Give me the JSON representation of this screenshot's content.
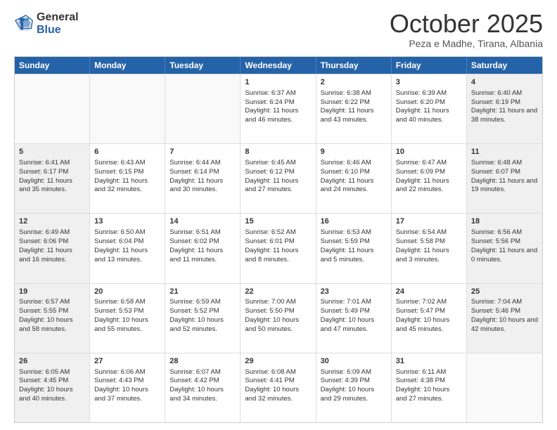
{
  "logo": {
    "general": "General",
    "blue": "Blue"
  },
  "header": {
    "month": "October 2025",
    "location": "Peza e Madhe, Tirana, Albania"
  },
  "days": [
    "Sunday",
    "Monday",
    "Tuesday",
    "Wednesday",
    "Thursday",
    "Friday",
    "Saturday"
  ],
  "rows": [
    [
      {
        "num": "",
        "info": "",
        "empty": true
      },
      {
        "num": "",
        "info": "",
        "empty": true
      },
      {
        "num": "",
        "info": "",
        "empty": true
      },
      {
        "num": "1",
        "info": "Sunrise: 6:37 AM\nSunset: 6:24 PM\nDaylight: 11 hours and 46 minutes."
      },
      {
        "num": "2",
        "info": "Sunrise: 6:38 AM\nSunset: 6:22 PM\nDaylight: 11 hours and 43 minutes."
      },
      {
        "num": "3",
        "info": "Sunrise: 6:39 AM\nSunset: 6:20 PM\nDaylight: 11 hours and 40 minutes."
      },
      {
        "num": "4",
        "info": "Sunrise: 6:40 AM\nSunset: 6:19 PM\nDaylight: 11 hours and 38 minutes.",
        "shaded": true
      }
    ],
    [
      {
        "num": "5",
        "info": "Sunrise: 6:41 AM\nSunset: 6:17 PM\nDaylight: 11 hours and 35 minutes.",
        "shaded": true
      },
      {
        "num": "6",
        "info": "Sunrise: 6:43 AM\nSunset: 6:15 PM\nDaylight: 11 hours and 32 minutes."
      },
      {
        "num": "7",
        "info": "Sunrise: 6:44 AM\nSunset: 6:14 PM\nDaylight: 11 hours and 30 minutes."
      },
      {
        "num": "8",
        "info": "Sunrise: 6:45 AM\nSunset: 6:12 PM\nDaylight: 11 hours and 27 minutes."
      },
      {
        "num": "9",
        "info": "Sunrise: 6:46 AM\nSunset: 6:10 PM\nDaylight: 11 hours and 24 minutes."
      },
      {
        "num": "10",
        "info": "Sunrise: 6:47 AM\nSunset: 6:09 PM\nDaylight: 11 hours and 22 minutes."
      },
      {
        "num": "11",
        "info": "Sunrise: 6:48 AM\nSunset: 6:07 PM\nDaylight: 11 hours and 19 minutes.",
        "shaded": true
      }
    ],
    [
      {
        "num": "12",
        "info": "Sunrise: 6:49 AM\nSunset: 6:06 PM\nDaylight: 11 hours and 16 minutes.",
        "shaded": true
      },
      {
        "num": "13",
        "info": "Sunrise: 6:50 AM\nSunset: 6:04 PM\nDaylight: 11 hours and 13 minutes."
      },
      {
        "num": "14",
        "info": "Sunrise: 6:51 AM\nSunset: 6:02 PM\nDaylight: 11 hours and 11 minutes."
      },
      {
        "num": "15",
        "info": "Sunrise: 6:52 AM\nSunset: 6:01 PM\nDaylight: 11 hours and 8 minutes."
      },
      {
        "num": "16",
        "info": "Sunrise: 6:53 AM\nSunset: 5:59 PM\nDaylight: 11 hours and 5 minutes."
      },
      {
        "num": "17",
        "info": "Sunrise: 6:54 AM\nSunset: 5:58 PM\nDaylight: 11 hours and 3 minutes."
      },
      {
        "num": "18",
        "info": "Sunrise: 6:56 AM\nSunset: 5:56 PM\nDaylight: 11 hours and 0 minutes.",
        "shaded": true
      }
    ],
    [
      {
        "num": "19",
        "info": "Sunrise: 6:57 AM\nSunset: 5:55 PM\nDaylight: 10 hours and 58 minutes.",
        "shaded": true
      },
      {
        "num": "20",
        "info": "Sunrise: 6:58 AM\nSunset: 5:53 PM\nDaylight: 10 hours and 55 minutes."
      },
      {
        "num": "21",
        "info": "Sunrise: 6:59 AM\nSunset: 5:52 PM\nDaylight: 10 hours and 52 minutes."
      },
      {
        "num": "22",
        "info": "Sunrise: 7:00 AM\nSunset: 5:50 PM\nDaylight: 10 hours and 50 minutes."
      },
      {
        "num": "23",
        "info": "Sunrise: 7:01 AM\nSunset: 5:49 PM\nDaylight: 10 hours and 47 minutes."
      },
      {
        "num": "24",
        "info": "Sunrise: 7:02 AM\nSunset: 5:47 PM\nDaylight: 10 hours and 45 minutes."
      },
      {
        "num": "25",
        "info": "Sunrise: 7:04 AM\nSunset: 5:46 PM\nDaylight: 10 hours and 42 minutes.",
        "shaded": true
      }
    ],
    [
      {
        "num": "26",
        "info": "Sunrise: 6:05 AM\nSunset: 4:45 PM\nDaylight: 10 hours and 40 minutes.",
        "shaded": true
      },
      {
        "num": "27",
        "info": "Sunrise: 6:06 AM\nSunset: 4:43 PM\nDaylight: 10 hours and 37 minutes."
      },
      {
        "num": "28",
        "info": "Sunrise: 6:07 AM\nSunset: 4:42 PM\nDaylight: 10 hours and 34 minutes."
      },
      {
        "num": "29",
        "info": "Sunrise: 6:08 AM\nSunset: 4:41 PM\nDaylight: 10 hours and 32 minutes."
      },
      {
        "num": "30",
        "info": "Sunrise: 6:09 AM\nSunset: 4:39 PM\nDaylight: 10 hours and 29 minutes."
      },
      {
        "num": "31",
        "info": "Sunrise: 6:11 AM\nSunset: 4:38 PM\nDaylight: 10 hours and 27 minutes."
      },
      {
        "num": "",
        "info": "",
        "empty": true
      }
    ]
  ]
}
